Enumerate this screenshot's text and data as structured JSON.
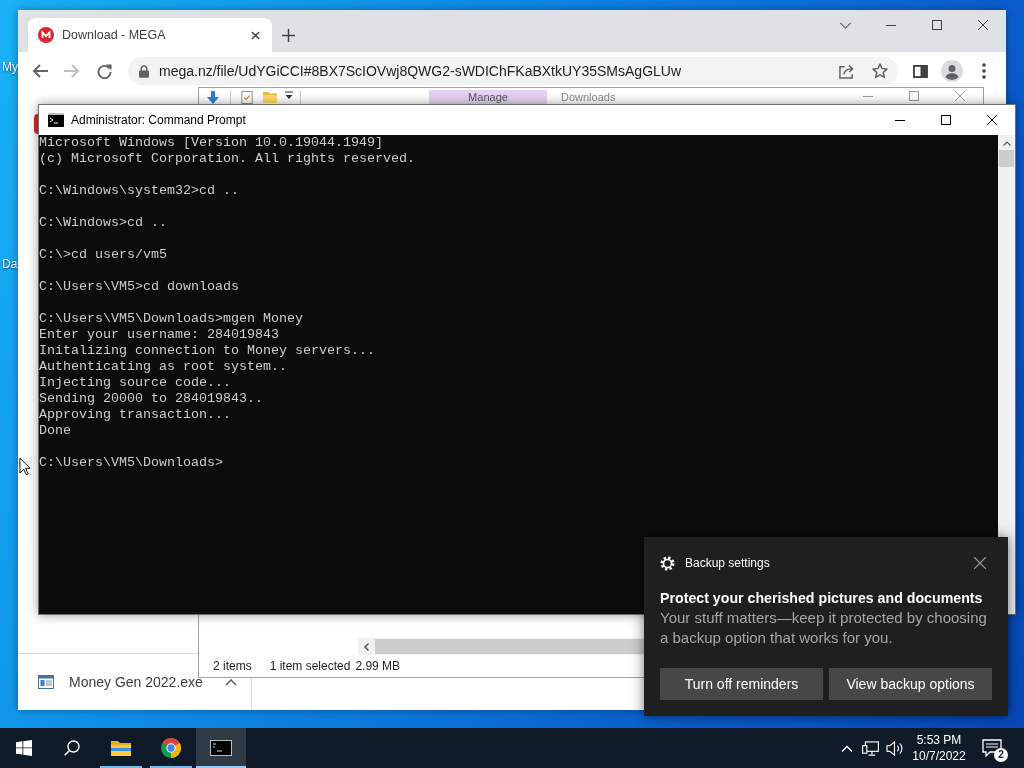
{
  "desktop": {
    "icon_labels": [
      "My",
      "Da"
    ]
  },
  "browser": {
    "tabs": [
      {
        "title": "Download - MEGA",
        "selected": true
      }
    ],
    "nav_buttons": [
      {
        "kind": "back",
        "disabled": false
      },
      {
        "kind": "forward",
        "disabled": true
      },
      {
        "kind": "reload",
        "disabled": false
      }
    ],
    "url": "mega.nz/file/UdYGiCCI#8BX7ScIOVwj8QWG2-sWDIChFKaBXtkUY35SMsAgGLUw",
    "downloads": [
      {
        "file_name": "Money Gen 2022.exe"
      }
    ]
  },
  "file_explorer": {
    "ribbon_tab": "Manage",
    "title": "Downloads",
    "status_bar": {
      "item_count": "2 items",
      "selection": "1 item selected",
      "size": "2.99 MB"
    }
  },
  "command_prompt": {
    "title": "Administrator: Command Prompt",
    "blocks": [
      [
        "Microsoft Windows [Version 10.0.19044.1949]",
        "(c) Microsoft Corporation. All rights reserved."
      ],
      [
        "C:\\Windows\\system32>cd .."
      ],
      [
        "C:\\Windows>cd .."
      ],
      [
        "C:\\>cd users/vm5"
      ],
      [
        "C:\\Users\\VM5>cd downloads"
      ],
      [
        "C:\\Users\\VM5\\Downloads>mgen Money",
        "Enter your username: 284019843",
        "Initalizing connection to Money servers...",
        "Authenticating as root system..",
        "Injecting source code...",
        "Sending 20000 to 284019843..",
        "Approving transaction...",
        "Done"
      ],
      [
        "C:\\Users\\VM5\\Downloads>"
      ]
    ]
  },
  "notification": {
    "app_name": "Backup settings",
    "title": "Protect your cherished pictures and documents",
    "body": "Your stuff matters—keep it protected by choosing a backup option that works for you.",
    "buttons": [
      "Turn off reminders",
      "View backup options"
    ]
  },
  "taskbar": {
    "apps": [
      {
        "kind": "file_explorer",
        "running": true,
        "selected": false
      },
      {
        "kind": "browser",
        "running": true,
        "selected": false
      },
      {
        "kind": "terminal",
        "running": true,
        "selected": true
      }
    ],
    "clock": {
      "time": "5:53 PM",
      "date": "10/7/2022"
    },
    "notification_count": "2"
  }
}
